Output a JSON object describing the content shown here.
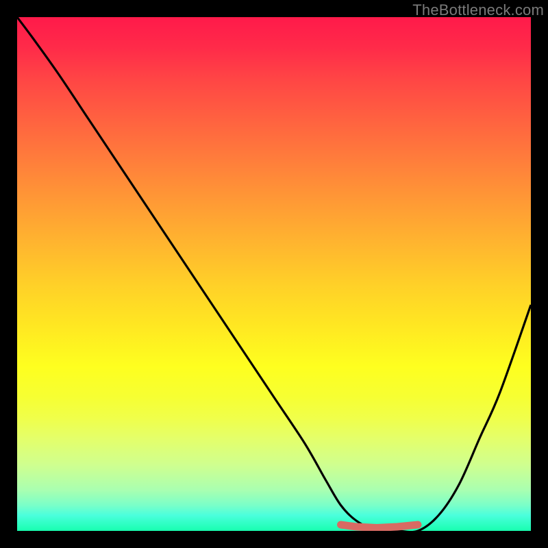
{
  "watermark": "TheBottleneck.com",
  "chart_data": {
    "type": "line",
    "title": "",
    "xlabel": "",
    "ylabel": "",
    "xlim": [
      0,
      100
    ],
    "ylim": [
      0,
      100
    ],
    "gradient_stops": [
      {
        "pct": 0,
        "color": "#ff1a4a"
      },
      {
        "pct": 12,
        "color": "#ff4545"
      },
      {
        "pct": 28,
        "color": "#ff7e3b"
      },
      {
        "pct": 44,
        "color": "#ffb52f"
      },
      {
        "pct": 60,
        "color": "#ffe722"
      },
      {
        "pct": 74,
        "color": "#f6ff33"
      },
      {
        "pct": 87,
        "color": "#d0ff8e"
      },
      {
        "pct": 100,
        "color": "#18ffaf"
      }
    ],
    "series": [
      {
        "name": "curve",
        "x": [
          0,
          3,
          8,
          14,
          20,
          26,
          32,
          38,
          44,
          50,
          56,
          60,
          63,
          66,
          70,
          74,
          78,
          82,
          86,
          90,
          94,
          100
        ],
        "y": [
          100,
          96,
          89,
          80,
          71,
          62,
          53,
          44,
          35,
          26,
          17,
          10,
          5,
          2,
          0,
          0,
          0,
          3,
          9,
          18,
          27,
          44
        ]
      },
      {
        "name": "bottom-marker",
        "x": [
          63,
          66,
          70,
          74,
          78
        ],
        "y": [
          1.2,
          0.8,
          0.6,
          0.8,
          1.2
        ]
      }
    ],
    "marker_color": "#d96a63"
  }
}
